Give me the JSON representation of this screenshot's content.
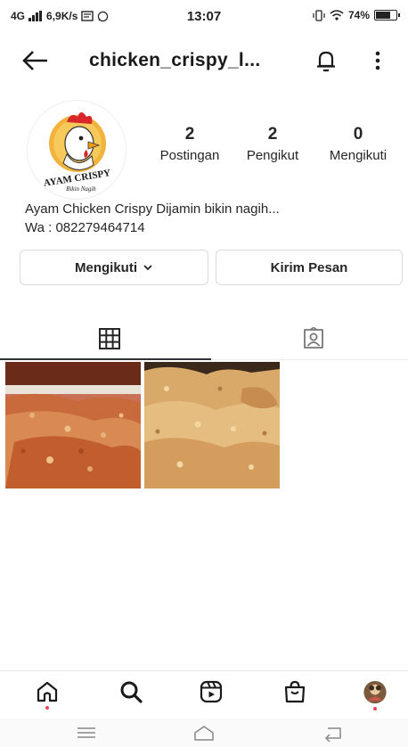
{
  "status_bar": {
    "network": "4G",
    "speed": "6,9K/s",
    "time": "13:07",
    "battery": "74%",
    "battery_level": 0.74
  },
  "header": {
    "username": "chicken_crispy_l..."
  },
  "profile": {
    "avatar_text_main": "AYAM CRISPY",
    "avatar_text_sub": "Bikin Nagih",
    "stats": [
      {
        "value": "2",
        "label": "Postingan"
      },
      {
        "value": "2",
        "label": "Pengikut"
      },
      {
        "value": "0",
        "label": "Mengikuti"
      }
    ],
    "bio_line1": "Ayam Chicken Crispy Dijamin bikin nagih...",
    "bio_line2": "Wa : 082279464714"
  },
  "actions": {
    "following_label": "Mengikuti",
    "message_label": "Kirim Pesan"
  },
  "tabs": [
    {
      "icon": "grid-icon",
      "active": true
    },
    {
      "icon": "tagged-icon",
      "active": false
    }
  ],
  "posts": [
    {
      "icon": "fried-chicken-photo"
    },
    {
      "icon": "fried-chicken-photo"
    }
  ],
  "bottom_nav": [
    {
      "icon": "home-icon"
    },
    {
      "icon": "search-icon"
    },
    {
      "icon": "reels-icon"
    },
    {
      "icon": "shop-icon"
    },
    {
      "icon": "profile-avatar-icon"
    }
  ],
  "colors": {
    "notification_dot": "#ed4956",
    "text": "#262626",
    "border": "#dbdbdb"
  }
}
